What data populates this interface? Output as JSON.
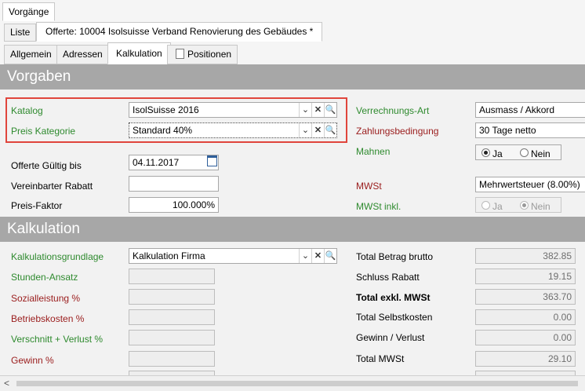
{
  "top_tab": "Vorgänge",
  "doc_tabs": [
    "Liste",
    "Offerte: 10004 Isolsuisse Verband Renovierung des Gebäudes *"
  ],
  "sub_tabs": [
    "Allgemein",
    "Adressen",
    "Kalkulation",
    "Positionen"
  ],
  "vorgaben": {
    "title": "Vorgaben",
    "katalog_label": "Katalog",
    "katalog_value": "IsolSuisse 2016",
    "preis_kategorie_label": "Preis Kategorie",
    "preis_kategorie_value": "Standard 40%",
    "gueltig_label": "Offerte Gültig bis",
    "gueltig_value": "04.11.2017",
    "rabatt_label": "Vereinbarter Rabatt",
    "rabatt_value": "",
    "faktor_label": "Preis-Faktor",
    "faktor_value": "100.000%",
    "verrechnung_label": "Verrechnungs-Art",
    "verrechnung_value": "Ausmass / Akkord",
    "zahlung_label": "Zahlungsbedingung",
    "zahlung_value": "30 Tage netto",
    "mahnen_label": "Mahnen",
    "mahnen_ja": "Ja",
    "mahnen_nein": "Nein",
    "mwst_label": "MWSt",
    "mwst_value": "Mehrwertsteuer (8.00%)",
    "mwst_inkl_label": "MWSt inkl.",
    "mwst_inkl_ja": "Ja",
    "mwst_inkl_nein": "Nein"
  },
  "kalkulation": {
    "title": "Kalkulation",
    "grundlage_label": "Kalkulationsgrundlage",
    "grundlage_value": "Kalkulation Firma",
    "stunden_label": "Stunden-Ansatz",
    "sozial_label": "Sozialleistung %",
    "betrieb_label": "Betriebskosten %",
    "verschnitt_label": "Verschnitt + Verlust %",
    "gewinn_label": "Gewinn %",
    "totals": [
      {
        "label": "Total Betrag brutto",
        "value": "382.85"
      },
      {
        "label": "Schluss Rabatt",
        "value": "19.15"
      },
      {
        "label": "Total exkl. MWSt",
        "value": "363.70"
      },
      {
        "label": "Total Selbstkosten",
        "value": "0.00"
      },
      {
        "label": "Gewinn / Verlust",
        "value": "0.00"
      },
      {
        "label": "Total MWSt",
        "value": "29.10"
      }
    ]
  }
}
